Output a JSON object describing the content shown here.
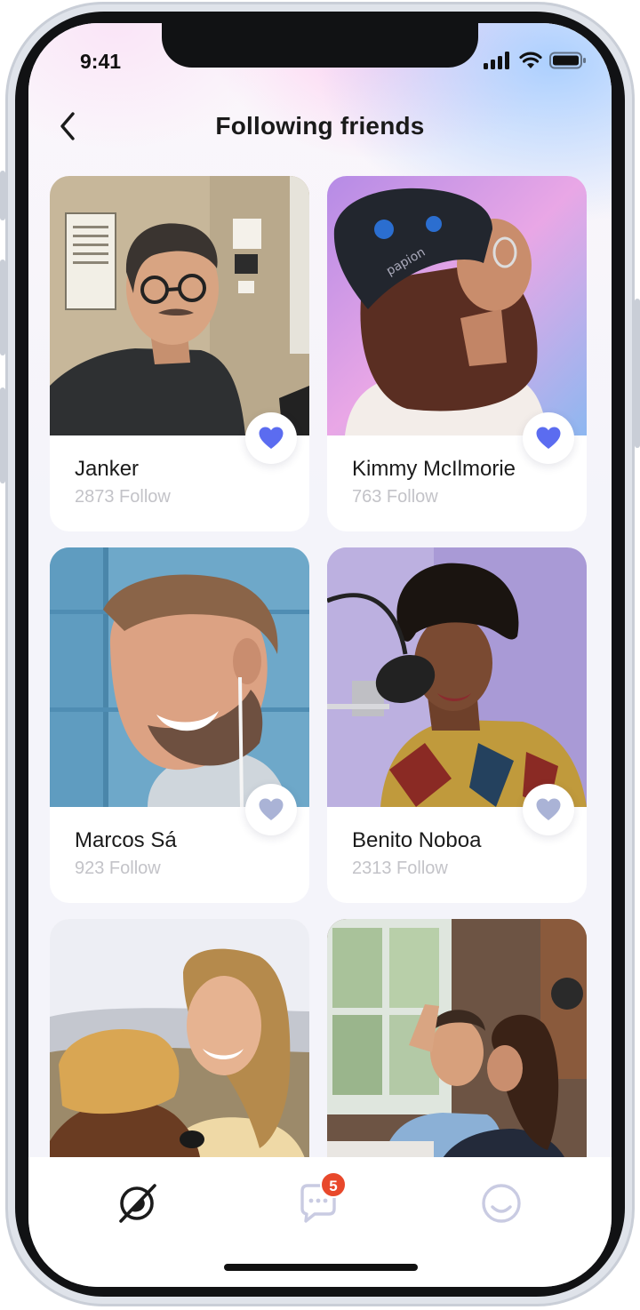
{
  "status": {
    "time": "9:41"
  },
  "header": {
    "title": "Following friends"
  },
  "friends": [
    {
      "name": "Janker",
      "follow": "2873 Follow",
      "liked": true
    },
    {
      "name": "Kimmy McIlmorie",
      "follow": "763 Follow",
      "liked": true
    },
    {
      "name": "Marcos Sá",
      "follow": "923 Follow",
      "liked": false
    },
    {
      "name": "Benito Noboa",
      "follow": "2313 Follow",
      "liked": false
    },
    {
      "name": "",
      "follow": "",
      "liked": false
    },
    {
      "name": "",
      "follow": "",
      "liked": false
    }
  ],
  "tabbar": {
    "items": [
      {
        "icon": "explore-icon",
        "active": true
      },
      {
        "icon": "chat-icon",
        "active": false,
        "badge": "5"
      },
      {
        "icon": "profile-smile-icon",
        "active": false
      }
    ]
  },
  "colors": {
    "heart_active": "#5b6cf0",
    "heart_inactive": "#aab3d6",
    "badge": "#e8482b",
    "tab_active": "#1b1b1b",
    "tab_inactive": "#c9cbe2"
  }
}
